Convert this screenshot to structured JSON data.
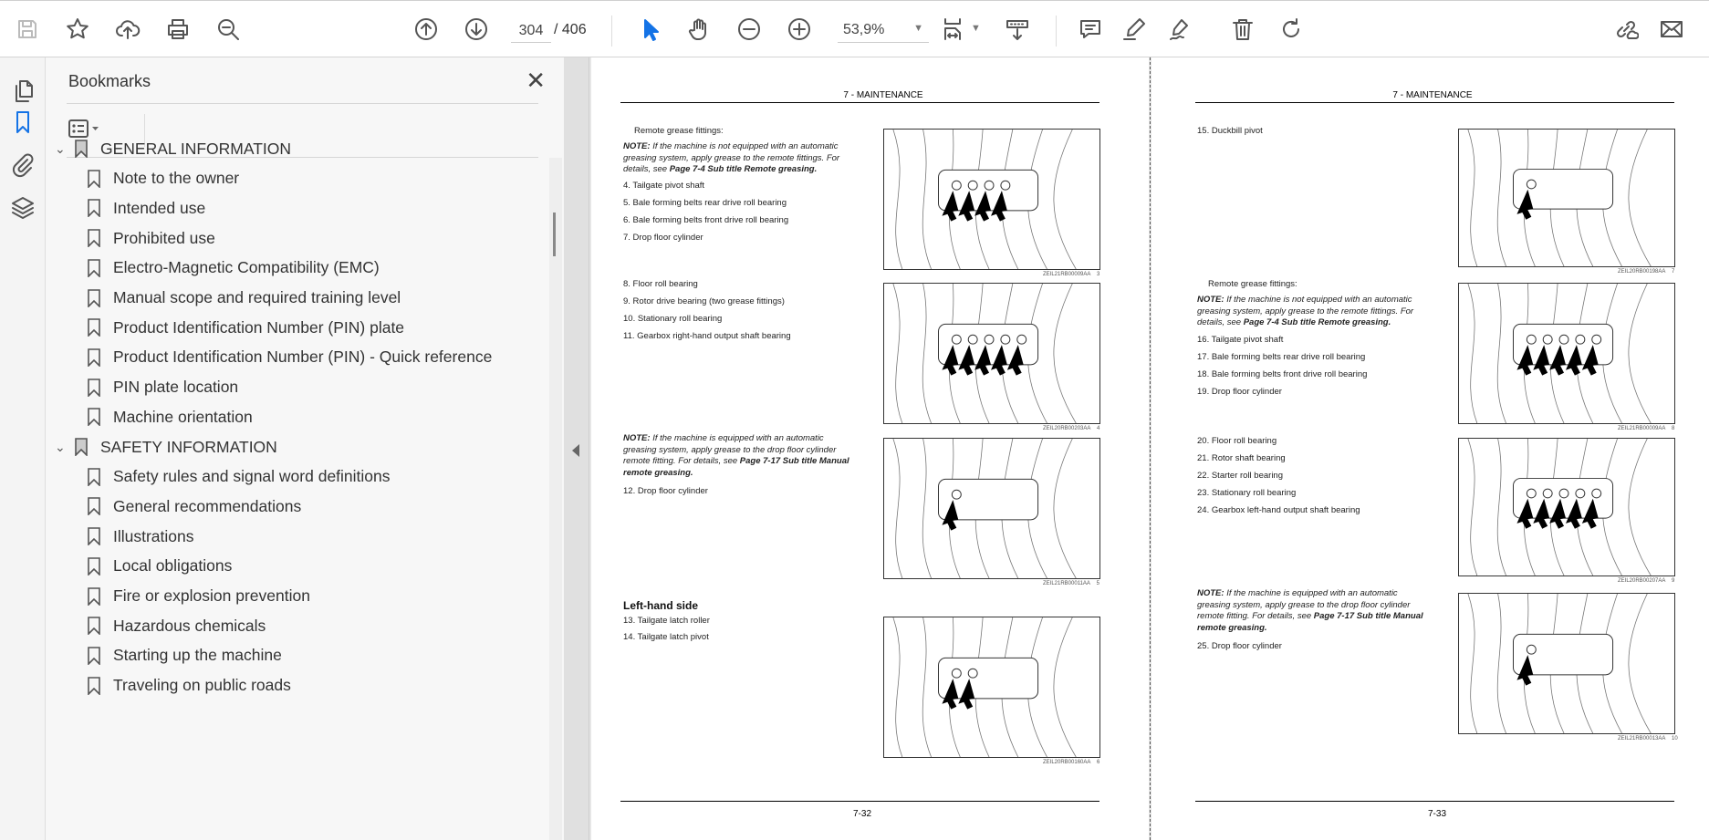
{
  "toolbar": {
    "page_current": "304",
    "page_total": "/ 406",
    "zoom": "53,9%"
  },
  "bookmarks": {
    "title": "Bookmarks",
    "items": [
      {
        "label": "GENERAL INFORMATION",
        "level": 0
      },
      {
        "label": "Note to the owner",
        "level": 1
      },
      {
        "label": "Intended use",
        "level": 1
      },
      {
        "label": "Prohibited use",
        "level": 1
      },
      {
        "label": "Electro-Magnetic Compatibility (EMC)",
        "level": 1
      },
      {
        "label": "Manual scope and required training level",
        "level": 1
      },
      {
        "label": "Product Identification Number (PIN) plate",
        "level": 1
      },
      {
        "label": "Product Identification Number (PIN) - Quick reference",
        "level": 1
      },
      {
        "label": "PIN plate location",
        "level": 1
      },
      {
        "label": "Machine orientation",
        "level": 1
      },
      {
        "label": "SAFETY INFORMATION",
        "level": 0
      },
      {
        "label": "Safety rules and signal word definitions",
        "level": 1
      },
      {
        "label": "General recommendations",
        "level": 1
      },
      {
        "label": "Illustrations",
        "level": 1
      },
      {
        "label": "Local obligations",
        "level": 1
      },
      {
        "label": "Fire or explosion prevention",
        "level": 1
      },
      {
        "label": "Hazardous chemicals",
        "level": 1
      },
      {
        "label": "Starting up the machine",
        "level": 1
      },
      {
        "label": "Traveling on public roads",
        "level": 1
      }
    ]
  },
  "left_page": {
    "header": "7 - MAINTENANCE",
    "footer": "7-32",
    "remote": "Remote grease fittings:",
    "note1": {
      "prefix": "NOTE:",
      "text": " If the machine is not equipped with an automatic greasing system, apply grease to the remote fittings. For details, see ",
      "link": "Page 7-4 Sub title Remote greasing."
    },
    "items_a": [
      "4.  Tailgate pivot shaft",
      "5.  Bale forming belts rear drive roll bearing",
      "6.  Bale forming belts front drive roll bearing",
      "7.  Drop floor cylinder"
    ],
    "items_b": [
      "8.  Floor roll bearing",
      "9.  Rotor drive bearing (two grease fittings)",
      "10.  Stationary roll bearing",
      "11.  Gearbox right-hand output shaft bearing"
    ],
    "note2": {
      "prefix": "NOTE:",
      "text": " If the machine is equipped with an automatic greasing system, apply grease to the drop floor cylinder remote fitting. For details, see ",
      "link": "Page 7-17 Sub title Manual remote greasing."
    },
    "item12": "12.  Drop floor cylinder",
    "subheading": "Left-hand side",
    "items_c": [
      "13.  Tailgate latch roller",
      "14.  Tailgate latch pivot"
    ],
    "figures": [
      {
        "code": "ZEIL21RB00009AA",
        "num": "3"
      },
      {
        "code": "ZEIL20RB00203AA",
        "num": "4"
      },
      {
        "code": "ZEIL21RB00011AA",
        "num": "5"
      },
      {
        "code": "ZEIL20RB00160AA",
        "num": "6"
      }
    ]
  },
  "right_page": {
    "header": "7 - MAINTENANCE",
    "footer": "7-33",
    "item15": "15.  Duckbill pivot",
    "remote": "Remote grease fittings:",
    "note1": {
      "prefix": "NOTE:",
      "text": " If the machine is not equipped with an automatic greasing system, apply grease to the remote fittings. For details, see ",
      "link": "Page 7-4 Sub title Remote greasing."
    },
    "items_a": [
      "16.  Tailgate pivot shaft",
      "17.  Bale forming belts rear drive roll bearing",
      "18.  Bale forming belts front drive roll bearing",
      "19.  Drop floor cylinder"
    ],
    "items_b": [
      "20.  Floor roll bearing",
      "21.  Rotor shaft bearing",
      "22.  Starter roll bearing",
      "23.  Stationary roll bearing",
      "24.  Gearbox left-hand output shaft bearing"
    ],
    "note2": {
      "prefix": "NOTE:",
      "text": " If the machine is equipped with an automatic greasing system, apply grease to the drop floor cylinder remote fitting. For details, see ",
      "link": "Page 7-17 Sub title Manual remote greasing."
    },
    "item25": "25.  Drop floor cylinder",
    "figures": [
      {
        "code": "ZEIL20RB00198AA",
        "num": "7"
      },
      {
        "code": "ZEIL21RB00009AA",
        "num": "8"
      },
      {
        "code": "ZEIL20RB00207AA",
        "num": "9"
      },
      {
        "code": "ZEIL21RB00013AA",
        "num": "10"
      }
    ]
  },
  "colors": {
    "accent": "#1473e6"
  }
}
